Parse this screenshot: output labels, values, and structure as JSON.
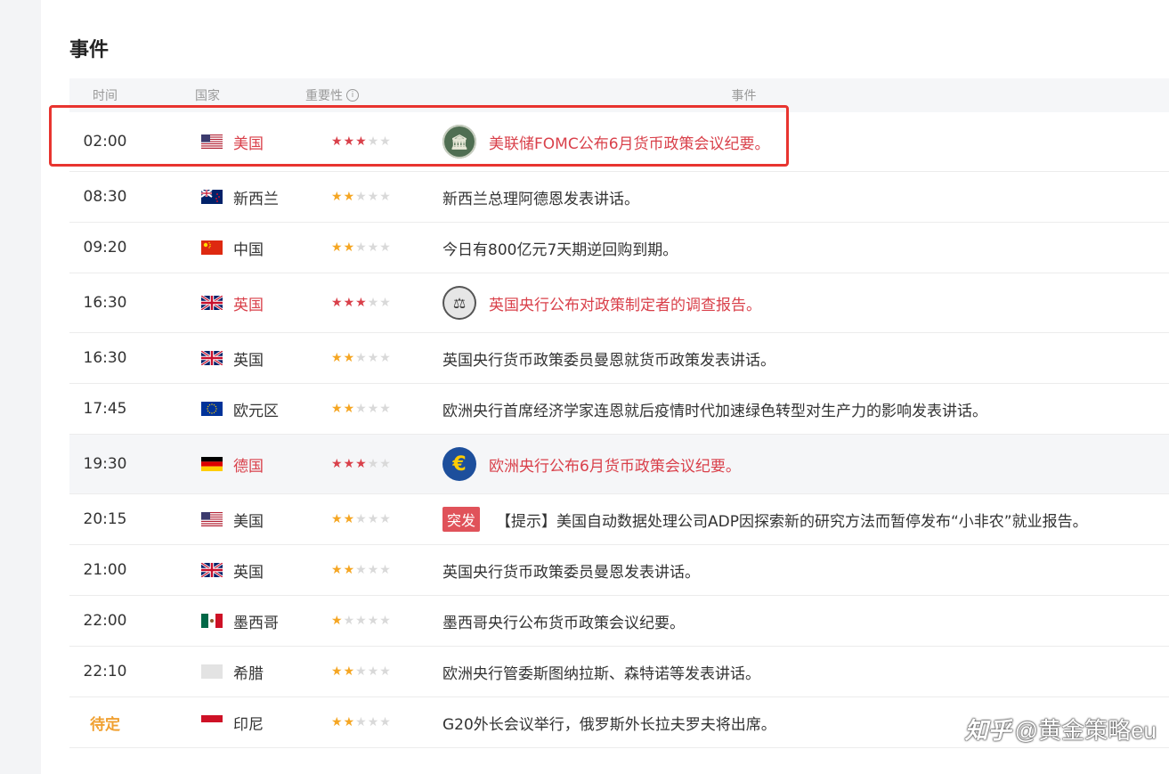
{
  "section_title": "事件",
  "headers": {
    "time": "时间",
    "country": "国家",
    "importance": "重要性",
    "info_symbol": "i",
    "event": "事件"
  },
  "badge_label": "突发",
  "logos": {
    "us": "🏛",
    "uk": "⚖",
    "de": "€"
  },
  "colors": {
    "accent_red": "#d9404a",
    "star_gold": "#f5a623",
    "pending_orange": "#f0a030",
    "highlight_border": "#e8342f"
  },
  "rows": [
    {
      "time": "02:00",
      "country": "美国",
      "flag": "us",
      "stars": 3,
      "red": true,
      "logo": "us",
      "event": "美联储FOMC公布6月货币政策会议纪要。"
    },
    {
      "time": "08:30",
      "country": "新西兰",
      "flag": "nz",
      "stars": 2,
      "red": false,
      "event": "新西兰总理阿德恩发表讲话。"
    },
    {
      "time": "09:20",
      "country": "中国",
      "flag": "cn",
      "stars": 2,
      "red": false,
      "event": "今日有800亿元7天期逆回购到期。"
    },
    {
      "time": "16:30",
      "country": "英国",
      "flag": "uk",
      "stars": 3,
      "red": true,
      "logo": "uk",
      "event": "英国央行公布对政策制定者的调查报告。"
    },
    {
      "time": "16:30",
      "country": "英国",
      "flag": "uk",
      "stars": 2,
      "red": false,
      "event": "英国央行货币政策委员曼恩就货币政策发表讲话。"
    },
    {
      "time": "17:45",
      "country": "欧元区",
      "flag": "eu",
      "stars": 2,
      "red": false,
      "event": "欧洲央行首席经济学家连恩就后疫情时代加速绿色转型对生产力的影响发表讲话。"
    },
    {
      "time": "19:30",
      "country": "德国",
      "flag": "de",
      "stars": 3,
      "red": true,
      "logo": "de",
      "event": "欧洲央行公布6月货币政策会议纪要。",
      "shaded": true
    },
    {
      "time": "20:15",
      "country": "美国",
      "flag": "us",
      "stars": 2,
      "red": false,
      "badge": true,
      "event": "【提示】美国自动数据处理公司ADP因探索新的研究方法而暂停发布“小非农”就业报告。"
    },
    {
      "time": "21:00",
      "country": "英国",
      "flag": "uk",
      "stars": 2,
      "red": false,
      "event": "英国央行货币政策委员曼恩发表讲话。"
    },
    {
      "time": "22:00",
      "country": "墨西哥",
      "flag": "mx",
      "stars": 1,
      "red": false,
      "event": "墨西哥央行公布货币政策会议纪要。"
    },
    {
      "time": "22:10",
      "country": "希腊",
      "flag": "gr",
      "stars": 2,
      "red": false,
      "event": "欧洲央行管委斯图纳拉斯、森特诺等发表讲话。"
    },
    {
      "time": "待定",
      "country": "印尼",
      "flag": "id",
      "stars": 2,
      "red": false,
      "pending": true,
      "event": "G20外长会议举行，俄罗斯外长拉夫罗夫将出席。"
    }
  ],
  "watermark": {
    "zhihu": "知乎",
    "handle": "@黄金策略eu"
  }
}
